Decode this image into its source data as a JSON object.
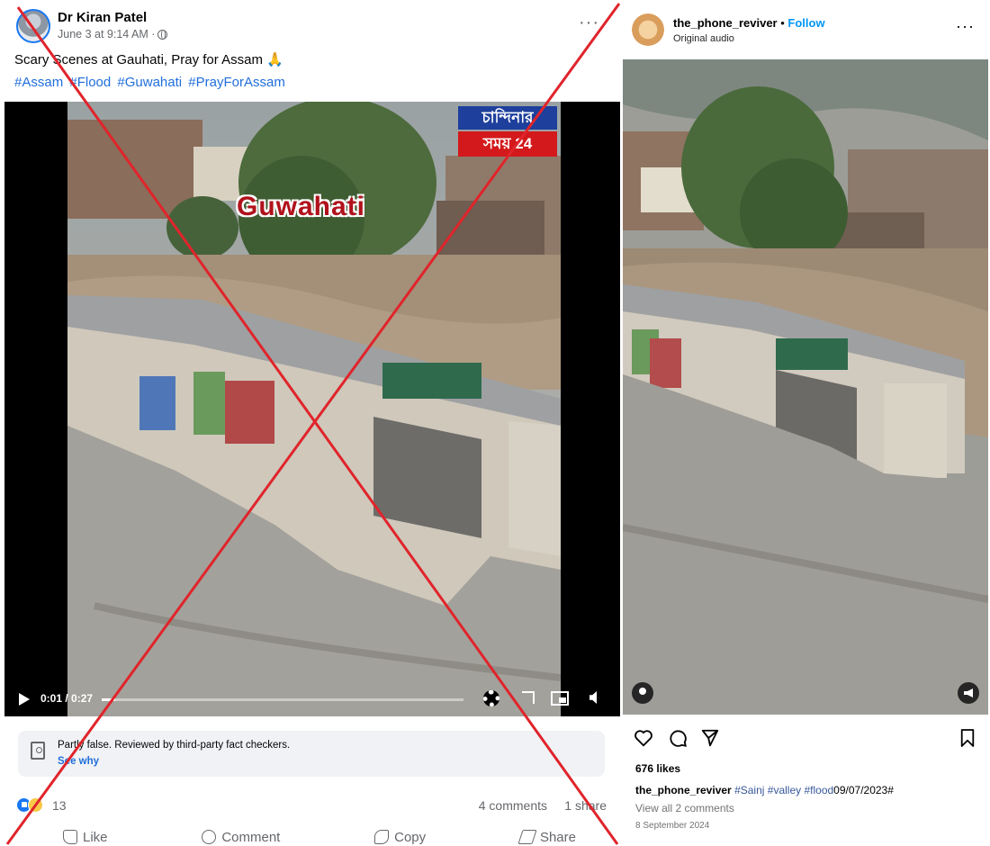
{
  "facebook_post": {
    "author": "Dr Kiran Patel",
    "meta": "June 3 at 9:14 AM ·",
    "more": "···",
    "caption": "Scary Scenes at Gauhati, Pray for Assam 🙏",
    "hashtags": [
      "#Assam",
      "#Flood",
      "#Guwahati",
      "#PrayForAssam"
    ],
    "video": {
      "badge_top": "চান্দিনার",
      "badge_bottom": "সময় 24",
      "overlay_title": "Guwahati",
      "time": "0:01 / 0:27",
      "progress": 0.037
    },
    "fact_check": {
      "text": "Partly false. Reviewed by third-party fact checkers.",
      "link": "See why"
    },
    "reactions_count": "13",
    "comments": "4 comments",
    "shares": "1 share",
    "actions": {
      "like": "Like",
      "comment": "Comment",
      "copy": "Copy",
      "share": "Share"
    }
  },
  "instagram_post": {
    "username": "the_phone_reviver",
    "separator": "•",
    "follow": "Follow",
    "audio": "Original audio",
    "more": "···",
    "likes": "676 likes",
    "caption_user": "the_phone_reviver",
    "caption_tags": [
      "#Sainj",
      "#valley",
      "#flood"
    ],
    "caption_tail": "09/07/2023#",
    "view_comments": "View all 2 comments",
    "date": "8 September 2024"
  },
  "colors": {
    "fb_link": "#216fdb",
    "ig_follow": "#0095f6",
    "strike": "#e0242b"
  }
}
